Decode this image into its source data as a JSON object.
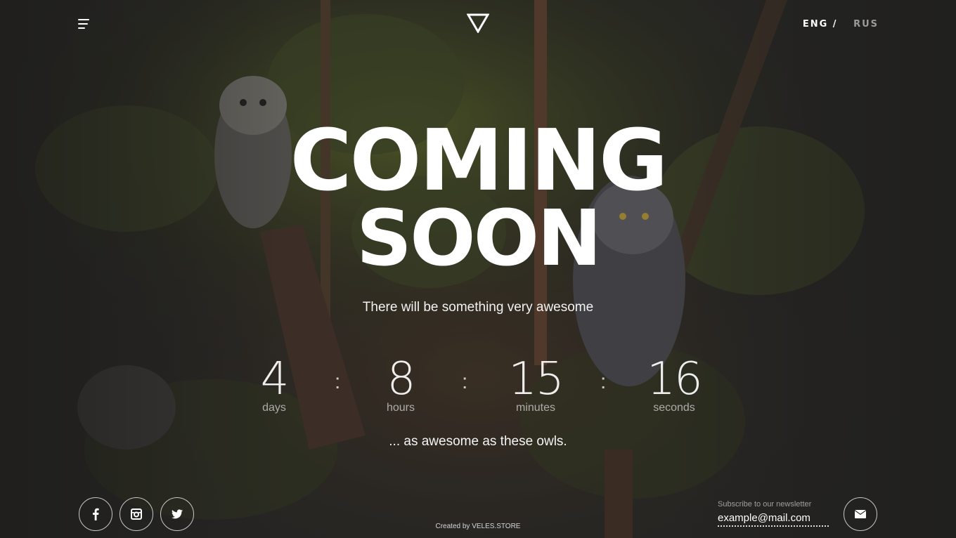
{
  "header": {
    "lang_active": "ENG",
    "lang_separator": "/",
    "lang_inactive": "RUS"
  },
  "hero": {
    "title_line1": "COMING",
    "title_line2": "SOON",
    "subtitle": "There will be something very awesome",
    "tagline": "... as awesome as these owls."
  },
  "countdown": [
    {
      "value": "4",
      "label": "days"
    },
    {
      "value": "8",
      "label": "hours"
    },
    {
      "value": "15",
      "label": "minutes"
    },
    {
      "value": "16",
      "label": "seconds"
    }
  ],
  "countdown_separator": ":",
  "footer": {
    "social": [
      {
        "icon": "facebook-icon"
      },
      {
        "icon": "instagram-icon"
      },
      {
        "icon": "twitter-icon"
      }
    ],
    "credit": "Created by VELES.STORE",
    "newsletter_label": "Subscribe to our newsletter",
    "newsletter_placeholder": "example@mail.com",
    "subscribe_icon": "envelope-icon"
  },
  "colors": {
    "text": "#ffffff",
    "background": "#2b2a28",
    "foliage": "#5d6a2a"
  }
}
